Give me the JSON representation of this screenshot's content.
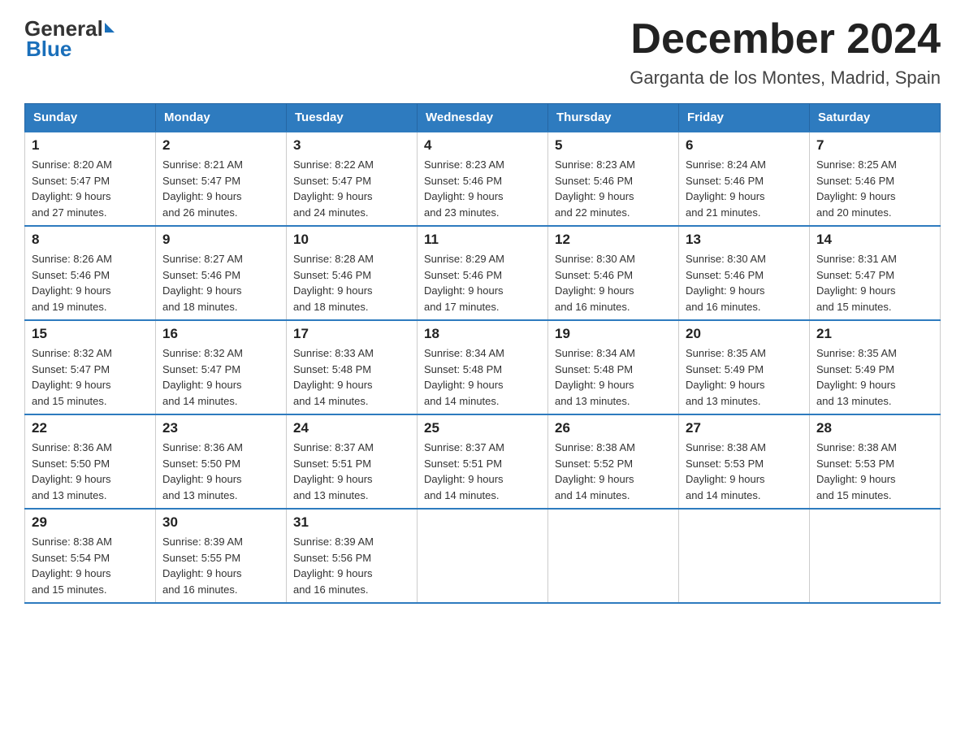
{
  "logo": {
    "general": "General",
    "blue": "Blue"
  },
  "header": {
    "title": "December 2024",
    "subtitle": "Garganta de los Montes, Madrid, Spain"
  },
  "days_of_week": [
    "Sunday",
    "Monday",
    "Tuesday",
    "Wednesday",
    "Thursday",
    "Friday",
    "Saturday"
  ],
  "weeks": [
    [
      {
        "day": "1",
        "sunrise": "8:20 AM",
        "sunset": "5:47 PM",
        "daylight": "9 hours and 27 minutes."
      },
      {
        "day": "2",
        "sunrise": "8:21 AM",
        "sunset": "5:47 PM",
        "daylight": "9 hours and 26 minutes."
      },
      {
        "day": "3",
        "sunrise": "8:22 AM",
        "sunset": "5:47 PM",
        "daylight": "9 hours and 24 minutes."
      },
      {
        "day": "4",
        "sunrise": "8:23 AM",
        "sunset": "5:46 PM",
        "daylight": "9 hours and 23 minutes."
      },
      {
        "day": "5",
        "sunrise": "8:23 AM",
        "sunset": "5:46 PM",
        "daylight": "9 hours and 22 minutes."
      },
      {
        "day": "6",
        "sunrise": "8:24 AM",
        "sunset": "5:46 PM",
        "daylight": "9 hours and 21 minutes."
      },
      {
        "day": "7",
        "sunrise": "8:25 AM",
        "sunset": "5:46 PM",
        "daylight": "9 hours and 20 minutes."
      }
    ],
    [
      {
        "day": "8",
        "sunrise": "8:26 AM",
        "sunset": "5:46 PM",
        "daylight": "9 hours and 19 minutes."
      },
      {
        "day": "9",
        "sunrise": "8:27 AM",
        "sunset": "5:46 PM",
        "daylight": "9 hours and 18 minutes."
      },
      {
        "day": "10",
        "sunrise": "8:28 AM",
        "sunset": "5:46 PM",
        "daylight": "9 hours and 18 minutes."
      },
      {
        "day": "11",
        "sunrise": "8:29 AM",
        "sunset": "5:46 PM",
        "daylight": "9 hours and 17 minutes."
      },
      {
        "day": "12",
        "sunrise": "8:30 AM",
        "sunset": "5:46 PM",
        "daylight": "9 hours and 16 minutes."
      },
      {
        "day": "13",
        "sunrise": "8:30 AM",
        "sunset": "5:46 PM",
        "daylight": "9 hours and 16 minutes."
      },
      {
        "day": "14",
        "sunrise": "8:31 AM",
        "sunset": "5:47 PM",
        "daylight": "9 hours and 15 minutes."
      }
    ],
    [
      {
        "day": "15",
        "sunrise": "8:32 AM",
        "sunset": "5:47 PM",
        "daylight": "9 hours and 15 minutes."
      },
      {
        "day": "16",
        "sunrise": "8:32 AM",
        "sunset": "5:47 PM",
        "daylight": "9 hours and 14 minutes."
      },
      {
        "day": "17",
        "sunrise": "8:33 AM",
        "sunset": "5:48 PM",
        "daylight": "9 hours and 14 minutes."
      },
      {
        "day": "18",
        "sunrise": "8:34 AM",
        "sunset": "5:48 PM",
        "daylight": "9 hours and 14 minutes."
      },
      {
        "day": "19",
        "sunrise": "8:34 AM",
        "sunset": "5:48 PM",
        "daylight": "9 hours and 13 minutes."
      },
      {
        "day": "20",
        "sunrise": "8:35 AM",
        "sunset": "5:49 PM",
        "daylight": "9 hours and 13 minutes."
      },
      {
        "day": "21",
        "sunrise": "8:35 AM",
        "sunset": "5:49 PM",
        "daylight": "9 hours and 13 minutes."
      }
    ],
    [
      {
        "day": "22",
        "sunrise": "8:36 AM",
        "sunset": "5:50 PM",
        "daylight": "9 hours and 13 minutes."
      },
      {
        "day": "23",
        "sunrise": "8:36 AM",
        "sunset": "5:50 PM",
        "daylight": "9 hours and 13 minutes."
      },
      {
        "day": "24",
        "sunrise": "8:37 AM",
        "sunset": "5:51 PM",
        "daylight": "9 hours and 13 minutes."
      },
      {
        "day": "25",
        "sunrise": "8:37 AM",
        "sunset": "5:51 PM",
        "daylight": "9 hours and 14 minutes."
      },
      {
        "day": "26",
        "sunrise": "8:38 AM",
        "sunset": "5:52 PM",
        "daylight": "9 hours and 14 minutes."
      },
      {
        "day": "27",
        "sunrise": "8:38 AM",
        "sunset": "5:53 PM",
        "daylight": "9 hours and 14 minutes."
      },
      {
        "day": "28",
        "sunrise": "8:38 AM",
        "sunset": "5:53 PM",
        "daylight": "9 hours and 15 minutes."
      }
    ],
    [
      {
        "day": "29",
        "sunrise": "8:38 AM",
        "sunset": "5:54 PM",
        "daylight": "9 hours and 15 minutes."
      },
      {
        "day": "30",
        "sunrise": "8:39 AM",
        "sunset": "5:55 PM",
        "daylight": "9 hours and 16 minutes."
      },
      {
        "day": "31",
        "sunrise": "8:39 AM",
        "sunset": "5:56 PM",
        "daylight": "9 hours and 16 minutes."
      },
      null,
      null,
      null,
      null
    ]
  ],
  "labels": {
    "sunrise": "Sunrise:",
    "sunset": "Sunset:",
    "daylight": "Daylight:"
  }
}
